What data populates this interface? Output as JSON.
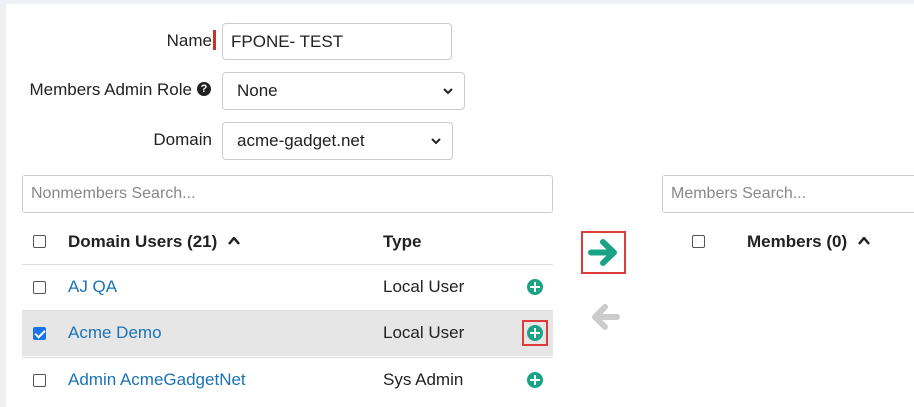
{
  "form": {
    "name_label": "Name",
    "name_value": "FPONE- TEST",
    "admin_role_label": "Members Admin Role",
    "admin_role_help": "?",
    "admin_role_value": "None",
    "domain_label": "Domain",
    "domain_value": "acme-gadget.net"
  },
  "nonmembers": {
    "search_placeholder": "Nonmembers Search...",
    "header_users": "Domain Users (21)",
    "header_type": "Type",
    "rows": [
      {
        "name": "AJ QA",
        "type": "Local User",
        "checked": false
      },
      {
        "name": "Acme Demo",
        "type": "Local User",
        "checked": true
      },
      {
        "name": "Admin AcmeGadgetNet",
        "type": "Sys Admin",
        "checked": false
      }
    ]
  },
  "members": {
    "search_placeholder": "Members Search...",
    "header": "Members (0)"
  },
  "icons": {
    "sort_asc": "caret-up-icon",
    "add": "plus-circle-icon",
    "move_right": "arrow-right-icon",
    "move_left": "arrow-left-icon",
    "select_chevron": "chevron-down-icon",
    "help": "question-circle-icon"
  },
  "colors": {
    "accent_green": "#1aa385",
    "link_blue": "#1a73b8",
    "highlight_red": "#e03b3b",
    "disabled_gray": "#cccccc"
  }
}
